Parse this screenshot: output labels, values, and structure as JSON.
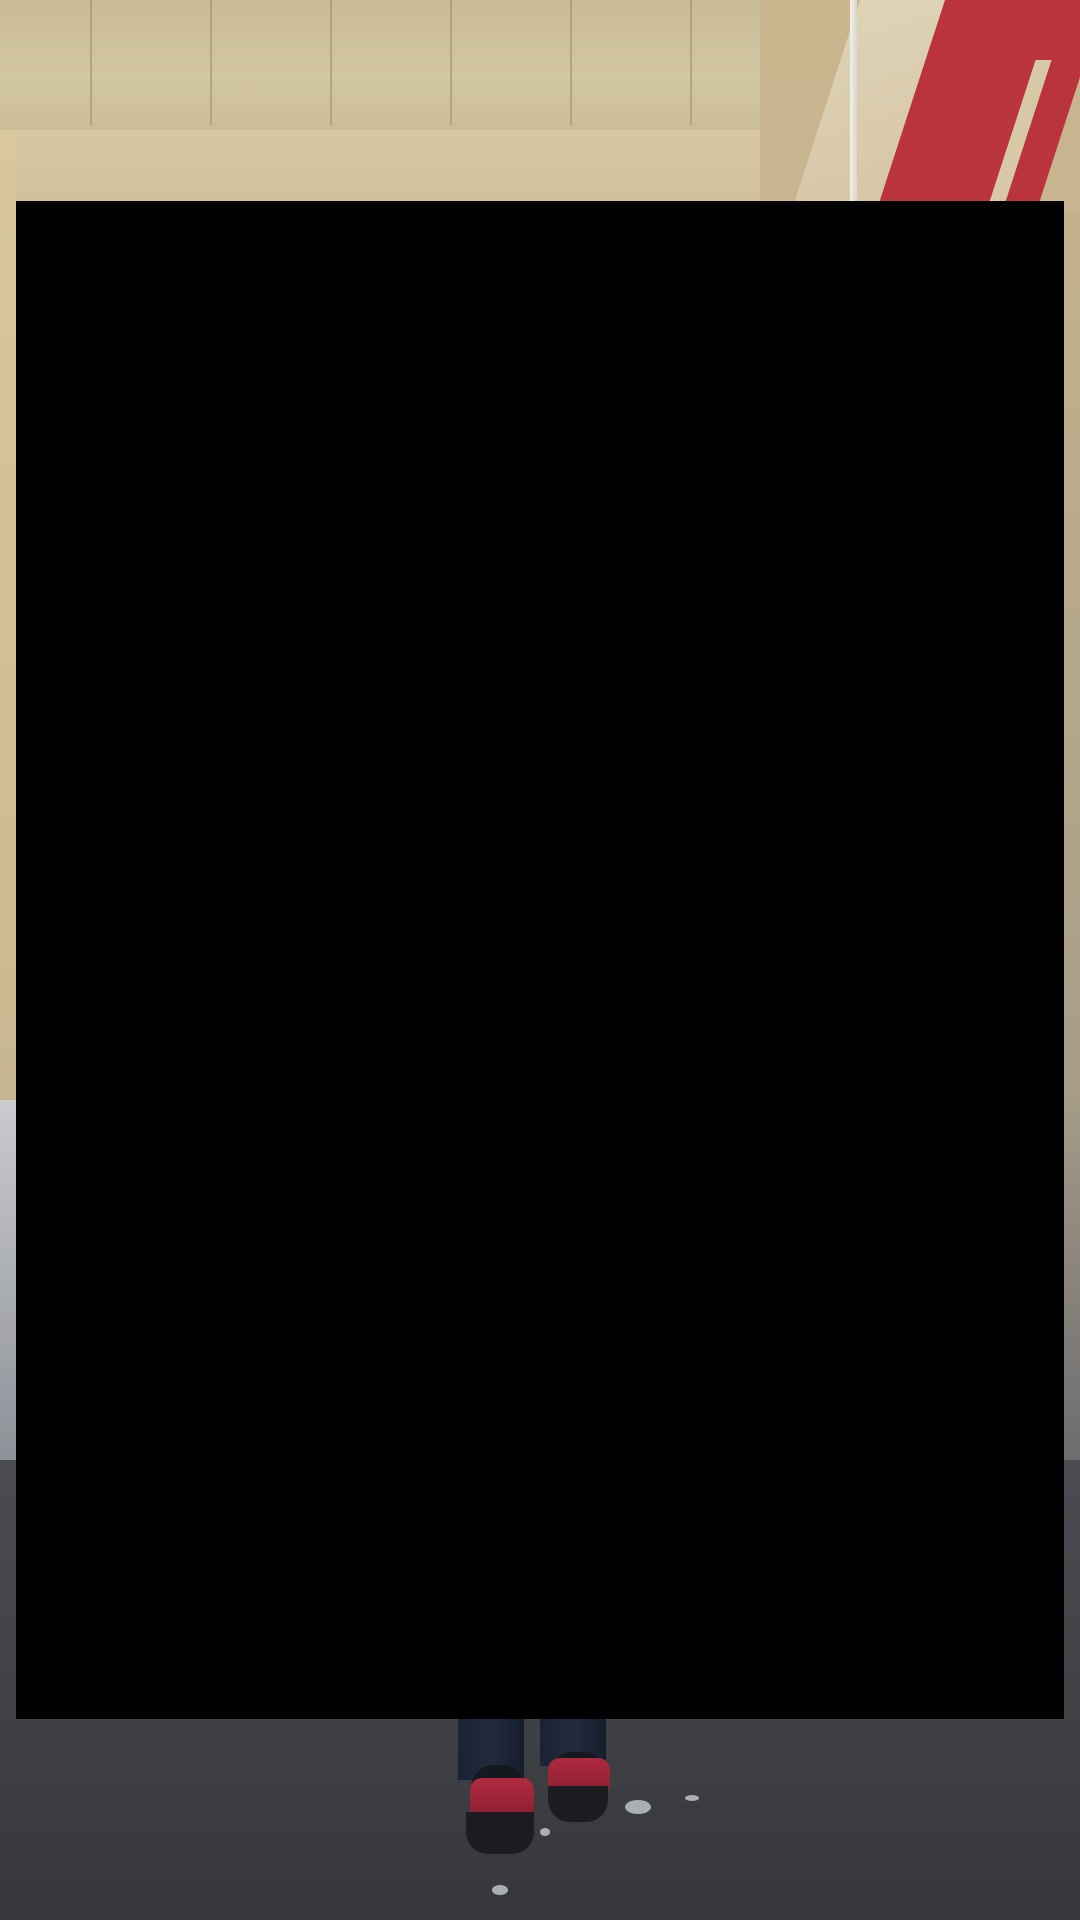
{
  "scene": {
    "description_label": "",
    "colors": {
      "ceiling": "#d3c6a3",
      "wall": "#cdbb91",
      "sign_red": "#b9343c",
      "floor": "#3e4044",
      "slipper_red": "#b02a40",
      "pants": "#1a2233",
      "overlay": "#000000"
    }
  }
}
